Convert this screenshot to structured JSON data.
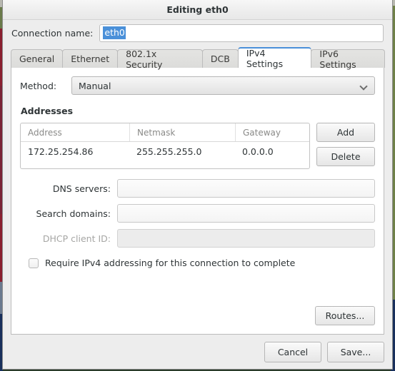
{
  "window": {
    "title": "Editing eth0"
  },
  "connection": {
    "label": "Connection name:",
    "value": "eth0",
    "selection_color": "#4a90d9"
  },
  "tabs": [
    {
      "label": "General",
      "active": false
    },
    {
      "label": "Ethernet",
      "active": false
    },
    {
      "label": "802.1x Security",
      "active": false
    },
    {
      "label": "DCB",
      "active": false
    },
    {
      "label": "IPv4 Settings",
      "active": true
    },
    {
      "label": "IPv6 Settings",
      "active": false
    }
  ],
  "ipv4": {
    "method_label": "Method:",
    "method_value": "Manual",
    "addresses_title": "Addresses",
    "table": {
      "columns": [
        "Address",
        "Netmask",
        "Gateway"
      ],
      "rows": [
        [
          "172.25.254.86",
          "255.255.255.0",
          "0.0.0.0"
        ]
      ]
    },
    "add_label": "Add",
    "delete_label": "Delete",
    "dns_label": "DNS servers:",
    "dns_value": "",
    "search_label": "Search domains:",
    "search_value": "",
    "dhcp_label": "DHCP client ID:",
    "dhcp_value": "",
    "require_label": "Require IPv4 addressing for this connection to complete",
    "routes_label": "Routes..."
  },
  "actions": {
    "cancel_label": "Cancel",
    "save_label": "Save..."
  }
}
